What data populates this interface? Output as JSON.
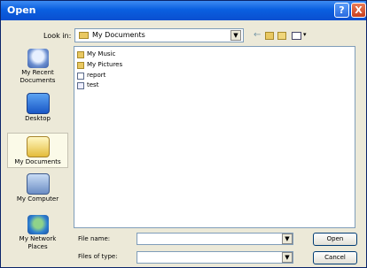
{
  "window": {
    "title": "Open",
    "help": "?",
    "close": "X"
  },
  "lookin": {
    "label": "Look in:",
    "value": "My Documents",
    "dropdown": "▼"
  },
  "toolbar": {
    "views_arrow": "▾",
    "back": "←"
  },
  "places": [
    {
      "label_line1": "My Recent",
      "label_line2": "Documents",
      "icon": "recent-icon"
    },
    {
      "label_line1": "Desktop",
      "label_line2": "",
      "icon": "desktop-icon"
    },
    {
      "label_line1": "My Documents",
      "label_line2": "",
      "icon": "my-documents-icon",
      "selected": true
    },
    {
      "label_line1": "My Computer",
      "label_line2": "",
      "icon": "my-computer-icon"
    },
    {
      "label_line1": "My Network",
      "label_line2": "Places",
      "icon": "network-places-icon"
    }
  ],
  "files": [
    {
      "name": "My Music",
      "icon": "music-folder-icon"
    },
    {
      "name": "My Pictures",
      "icon": "pictures-folder-icon"
    },
    {
      "name": "report",
      "icon": "document-icon"
    },
    {
      "name": "test",
      "icon": "text-file-icon"
    }
  ],
  "filename": {
    "label": "File name:",
    "value": "",
    "dropdown": "▼"
  },
  "filetype": {
    "label": "Files of type:",
    "value": "",
    "dropdown": "▼"
  },
  "buttons": {
    "open": "Open",
    "cancel": "Cancel"
  }
}
